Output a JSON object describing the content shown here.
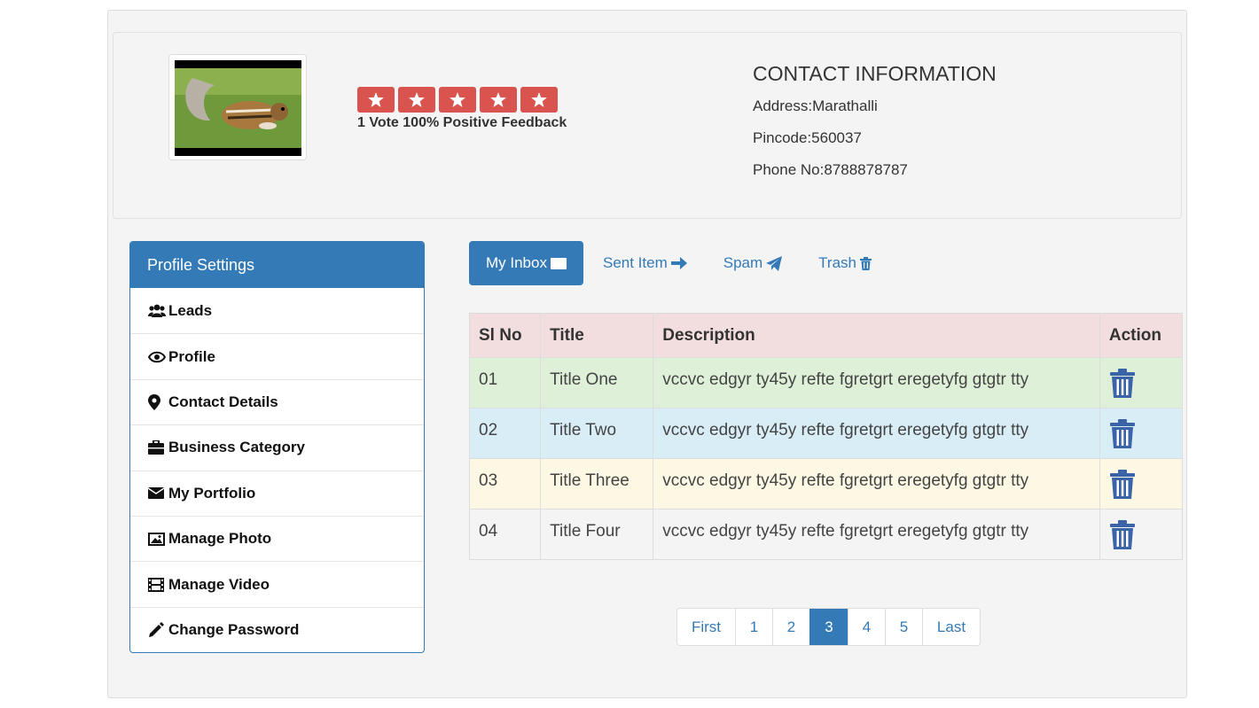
{
  "profile": {
    "rating_text": "1 Vote 100% Positive Feedback",
    "star_count": 5,
    "star_color": "#d9534f"
  },
  "contact": {
    "heading": "CONTACT INFORMATION",
    "address": "Address:Marathalli",
    "pincode": "Pincode:560037",
    "phone": "Phone No:8788878787"
  },
  "sidebar": {
    "title": "Profile Settings",
    "items": [
      {
        "label": "Leads",
        "icon": "users-icon"
      },
      {
        "label": "Profile",
        "icon": "eye-icon"
      },
      {
        "label": "Contact Details",
        "icon": "map-marker-icon"
      },
      {
        "label": "Business Category",
        "icon": "briefcase-icon"
      },
      {
        "label": "My Portfolio",
        "icon": "envelope-icon"
      },
      {
        "label": "Manage Photo",
        "icon": "picture-icon"
      },
      {
        "label": "Manage Video",
        "icon": "film-icon"
      },
      {
        "label": "Change Password",
        "icon": "pencil-icon"
      }
    ]
  },
  "tabs": [
    {
      "label": "My Inbox",
      "icon": "envelope-icon",
      "active": true
    },
    {
      "label": "Sent Item",
      "icon": "arrow-right-icon",
      "active": false
    },
    {
      "label": "Spam",
      "icon": "paper-plane-icon",
      "active": false
    },
    {
      "label": "Trash",
      "icon": "trash-icon",
      "active": false
    }
  ],
  "table": {
    "headers": [
      "Sl No",
      "Title",
      "Description",
      "Action"
    ],
    "rows": [
      {
        "sl": "01",
        "title": "Title One",
        "description": "vccvc edgyr ty45y refte fgretgrt eregetyfg gtgtr tty"
      },
      {
        "sl": "02",
        "title": "Title Two",
        "description": "vccvc edgyr ty45y refte fgretgrt eregetyfg gtgtr tty"
      },
      {
        "sl": "03",
        "title": "Title Three",
        "description": "vccvc edgyr ty45y refte fgretgrt eregetyfg gtgtr tty"
      },
      {
        "sl": "04",
        "title": "Title Four",
        "description": "vccvc edgyr ty45y refte fgretgrt eregetyfg gtgtr tty"
      }
    ]
  },
  "pagination": {
    "first": "First",
    "pages": [
      "1",
      "2",
      "3",
      "4",
      "5"
    ],
    "current": "3",
    "last": "Last"
  },
  "colors": {
    "primary": "#337ab7",
    "danger": "#d9534f",
    "trash_icon": "#3b64a8"
  }
}
